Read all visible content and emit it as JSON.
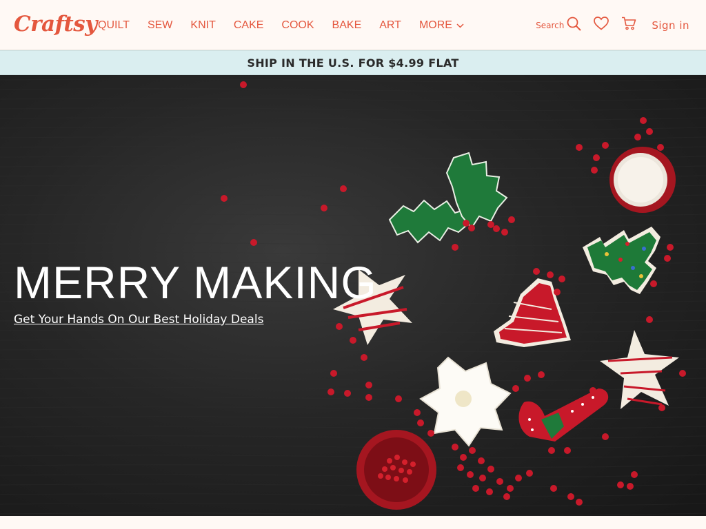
{
  "brand": {
    "logo_text": "Craftsy",
    "accent_color": "#e4573e"
  },
  "nav": {
    "items": [
      {
        "label": "QUILT"
      },
      {
        "label": "SEW"
      },
      {
        "label": "KNIT"
      },
      {
        "label": "CAKE"
      },
      {
        "label": "COOK"
      },
      {
        "label": "BAKE"
      },
      {
        "label": "ART"
      },
      {
        "label": "MORE"
      }
    ]
  },
  "tools": {
    "search_label": "Search",
    "search_icon": "search-icon",
    "wishlist_icon": "heart-icon",
    "cart_icon": "cart-icon",
    "signin_label": "Sign in"
  },
  "promo": {
    "text": "SHIP IN THE U.S. FOR $4.99 FLAT",
    "bg_color": "#daeef0"
  },
  "hero": {
    "title": "MERRY MAKING",
    "link_text": "Get Your Hands On Our Best Holiday Deals"
  }
}
